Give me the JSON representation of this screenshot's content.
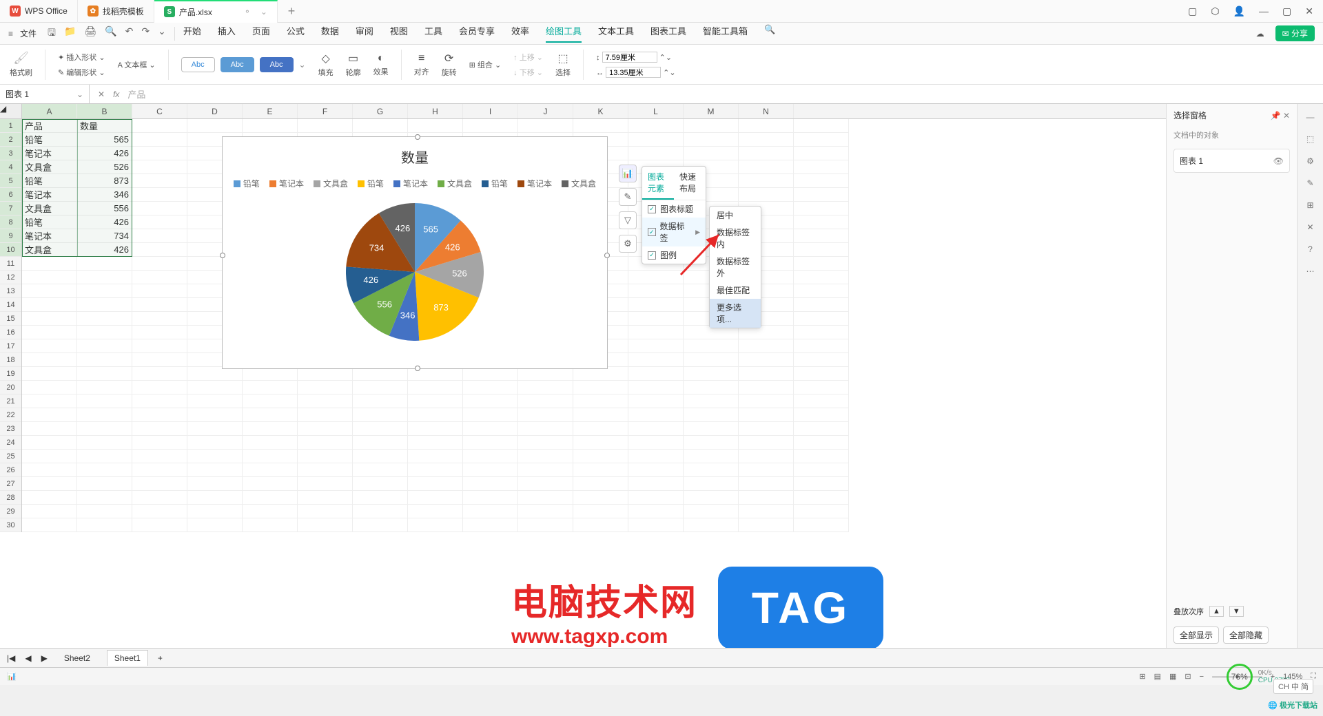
{
  "app": {
    "name": "WPS Office"
  },
  "tabs": [
    {
      "icon": "W",
      "iconClass": "red",
      "label": "WPS Office"
    },
    {
      "icon": "✿",
      "iconClass": "orange",
      "label": "找稻壳模板"
    },
    {
      "icon": "S",
      "iconClass": "green",
      "label": "产品.xlsx",
      "active": true
    }
  ],
  "menu": {
    "file": "文件",
    "items": [
      "开始",
      "插入",
      "页面",
      "公式",
      "数据",
      "审阅",
      "视图",
      "工具",
      "会员专享",
      "效率",
      "绘图工具",
      "文本工具",
      "图表工具",
      "智能工具箱"
    ],
    "active": "绘图工具"
  },
  "ribbon": {
    "brush": "格式刷",
    "insertShape": "插入形状",
    "textBox": "文本框",
    "editShape": "编辑形状",
    "abc": "Abc",
    "dd": "⌄",
    "fill": "填充",
    "outline": "轮廓",
    "effect": "效果",
    "align": "对齐",
    "rotate": "旋转",
    "group": "组合",
    "moveUp": "上移",
    "moveDown": "下移",
    "select": "选择",
    "height": "7.59厘米",
    "width": "13.35厘米"
  },
  "formula": {
    "name": "图表 1",
    "value": "产品"
  },
  "columns": [
    "A",
    "B",
    "C",
    "D",
    "E",
    "F",
    "G",
    "H",
    "I",
    "J",
    "K",
    "L",
    "M",
    "N"
  ],
  "grid": {
    "header": {
      "a": "产品",
      "b": "数量"
    },
    "rows": [
      {
        "a": "铅笔",
        "b": 565
      },
      {
        "a": "笔记本",
        "b": 426
      },
      {
        "a": "文具盒",
        "b": 526
      },
      {
        "a": "铅笔",
        "b": 873
      },
      {
        "a": "笔记本",
        "b": 346
      },
      {
        "a": "文具盒",
        "b": 556
      },
      {
        "a": "铅笔",
        "b": 426
      },
      {
        "a": "笔记本",
        "b": 734
      },
      {
        "a": "文具盒",
        "b": 426
      }
    ]
  },
  "chart_data": {
    "type": "pie",
    "title": "数量",
    "categories": [
      "铅笔",
      "笔记本",
      "文具盒",
      "铅笔",
      "笔记本",
      "文具盒",
      "铅笔",
      "笔记本",
      "文具盒"
    ],
    "values": [
      565,
      426,
      526,
      873,
      346,
      556,
      426,
      734,
      426
    ],
    "colors": [
      "#5b9bd5",
      "#ed7d31",
      "#a5a5a5",
      "#ffc000",
      "#4472c4",
      "#70ad47",
      "#255e91",
      "#9e480e",
      "#636363"
    ],
    "data_labels": true
  },
  "chart_menu": {
    "tab1": "图表元素",
    "tab2": "快速布局",
    "opt1": "图表标题",
    "opt2": "数据标签",
    "opt3": "图例",
    "sub": [
      "居中",
      "数据标签内",
      "数据标签外",
      "最佳匹配",
      "更多选项..."
    ]
  },
  "rightpane": {
    "title": "选择窗格",
    "subtitle": "文档中的对象",
    "item": "图表 1",
    "order": "叠放次序",
    "showAll": "全部显示",
    "hideAll": "全部隐藏"
  },
  "sheets": {
    "s1": "Sheet2",
    "s2": "Sheet1"
  },
  "status": {
    "zoom": "145%",
    "perf": "76%",
    "net": "0K/s",
    "cpu": "CPU 27°C",
    "ime": "CH 中 简"
  },
  "share": "分享",
  "watermark": {
    "line1": "电脑技术网",
    "line2": "www.tagxp.com",
    "tag": "TAG"
  },
  "dlsite": "极光下载站"
}
